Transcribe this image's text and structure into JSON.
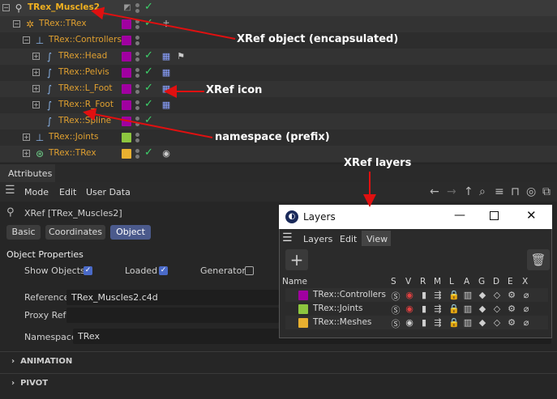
{
  "object_manager": {
    "rows": [
      {
        "name": "TRex_Muscles2",
        "swatch": "",
        "xref": ""
      },
      {
        "name": "TRex::TRex",
        "swatch": "#a000a0",
        "xref": ""
      },
      {
        "name": "TRex::Controllers",
        "swatch": "#a000a0",
        "xref": ""
      },
      {
        "name": "TRex::Head",
        "swatch": "#a000a0",
        "xref": "#8a7cff"
      },
      {
        "name": "TRex::Pelvis",
        "swatch": "#a000a0",
        "xref": "#8a7cff"
      },
      {
        "name": "TRex::L_Foot",
        "swatch": "#a000a0",
        "xref": "#8a7cff"
      },
      {
        "name": "TRex::R_Foot",
        "swatch": "#a000a0",
        "xref": ""
      },
      {
        "name": "TRex::Spline",
        "swatch": "#a000a0",
        "xref": ""
      },
      {
        "name": "TRex::Joints",
        "swatch": "#8dc63f",
        "xref": ""
      },
      {
        "name": "TRex::TRex",
        "swatch": "#e8b030",
        "xref": ""
      }
    ]
  },
  "attributes": {
    "tab": "Attributes",
    "menu": [
      "Mode",
      "Edit",
      "User Data"
    ],
    "object_title": "XRef [TRex_Muscles2]",
    "buttons": [
      "Basic",
      "Coordinates",
      "Object"
    ],
    "section_title": "Object Properties",
    "show_objects_label": "Show Objects",
    "loaded_label": "Loaded",
    "generator_label": "Generator",
    "reference_label": "Reference",
    "reference_value": "TRex_Muscles2.c4d",
    "proxy_label": "Proxy Ref",
    "namespace_label": "Namespace",
    "namespace_value": "TRex",
    "animation_label": "ANIMATION",
    "pivot_label": "PIVOT"
  },
  "layers": {
    "title": "Layers",
    "menu": [
      "Layers",
      "Edit",
      "View"
    ],
    "name_header": "Name",
    "columns": [
      "S",
      "V",
      "R",
      "M",
      "L",
      "A",
      "G",
      "D",
      "E",
      "X"
    ],
    "rows": [
      {
        "name": "TRex::Controllers",
        "color": "#a000a0"
      },
      {
        "name": "TRex::Joints",
        "color": "#8dc63f"
      },
      {
        "name": "TRex::Meshes",
        "color": "#e8b030"
      }
    ]
  },
  "annotations": {
    "xref_object": "XRef object (encapsulated)",
    "xref_icon": "XRef icon",
    "namespace": "namespace (prefix)",
    "xref_layers": "XRef layers"
  }
}
